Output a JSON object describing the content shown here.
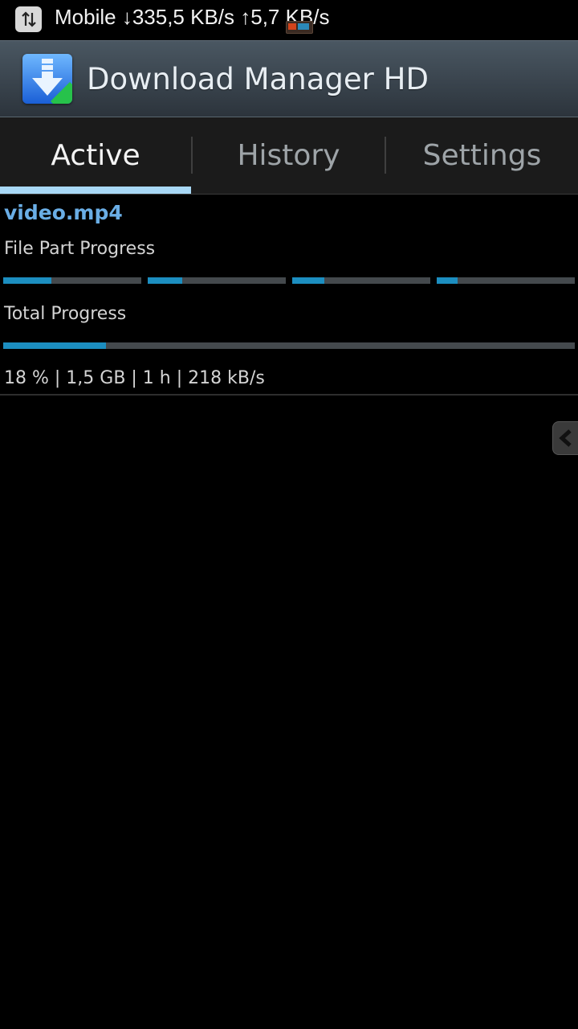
{
  "status_bar": {
    "text": "Mobile ↓335,5 KB/s ↑5,7 KB/s",
    "icon": "data-transfer-icon"
  },
  "app": {
    "title": "Download Manager HD",
    "icon": "download-arrow-icon"
  },
  "tabs": [
    {
      "label": "Active",
      "selected": true
    },
    {
      "label": "History",
      "selected": false
    },
    {
      "label": "Settings",
      "selected": false
    }
  ],
  "download": {
    "file_name": "video.mp4",
    "part_progress_label": "File Part Progress",
    "part_progress": [
      0.35,
      0.25,
      0.23,
      0.15
    ],
    "total_progress_label": "Total Progress",
    "total_progress": 0.18,
    "stats": "18 % | 1,5 GB | 1 h | 218 kB/s"
  },
  "colors": {
    "accent": "#6aaee6",
    "progress_fill": "#1c8ec0",
    "progress_track": "#44494d",
    "tab_indicator": "#a8d8f5"
  },
  "side_handle": {
    "icon": "chevron-left-icon"
  }
}
